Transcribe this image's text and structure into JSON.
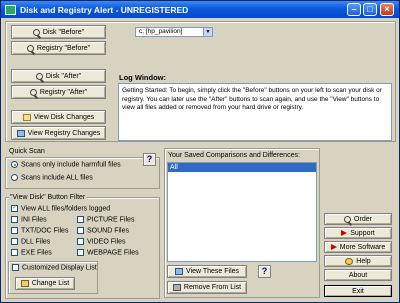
{
  "window": {
    "title": "Disk and Registry Alert - UNREGISTERED"
  },
  "before": {
    "disk_label": "Disk \"Before\"",
    "registry_label": "Registry \"Before\""
  },
  "drive": {
    "selected": "c: [hp_pavilion]"
  },
  "after": {
    "disk_label": "Disk \"After\"",
    "registry_label": "Registry \"After\""
  },
  "log": {
    "title": "Log Window:",
    "text": "Getting Started:  To begin, simply click the \"Before\" buttons on your left to scan your disk or registry.  You can later use the \"After\" buttons to scan again, and use the \"View\" buttons to view all files added or removed from your hard drive or registry."
  },
  "view": {
    "disk_changes": "View Disk Changes",
    "registry_changes": "View Registry Changes"
  },
  "quick_scan": {
    "title": "Quick Scan",
    "option_harmful": "Scans only include harmfull files",
    "option_all": "Scans include ALL files",
    "help": "?"
  },
  "comparisons": {
    "title": "Your Saved Comparisons and Differences:",
    "items": [
      "All"
    ],
    "view_files": "View These Files",
    "remove": "Remove From List",
    "help": "?"
  },
  "filter": {
    "title": "\"View Disk\" Button Filter",
    "view_all": "View ALL files/folders logged",
    "col1": [
      "INI Files",
      "TXT/DOC Files",
      "DLL Files",
      "EXE Files"
    ],
    "col2": [
      "PICTURE Files",
      "SOUND Files",
      "VIDEO Files",
      "WEBPAGE Files"
    ],
    "customized": "Customized Display List",
    "change_list": "Change List"
  },
  "side": {
    "order": "Order",
    "support": "Support",
    "more_software": "More Software",
    "help": "Help",
    "about": "About",
    "exit": "Exit"
  }
}
